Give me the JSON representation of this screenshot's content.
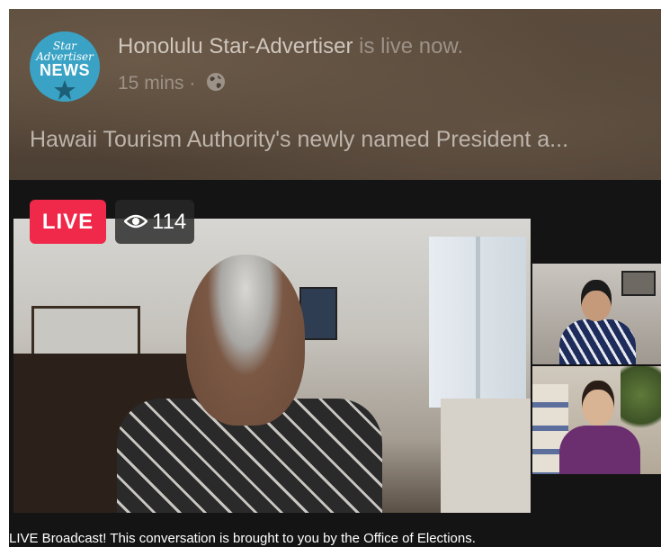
{
  "post": {
    "page_name": "Honolulu Star-Advertiser",
    "status_text": " is live now.",
    "time": "15 mins",
    "separator": " · ",
    "privacy_icon": "globe-icon",
    "caption": "Hawaii Tourism Authority's newly named President a..."
  },
  "avatar": {
    "line1": "Star",
    "line2": "Advertiser",
    "line3": "NEWS"
  },
  "video": {
    "live_label": "LIVE",
    "viewer_icon": "eye-icon",
    "viewer_count": "114"
  },
  "banner": {
    "text": "LIVE Broadcast! This conversation is brought to you by the Office of Elections."
  },
  "colors": {
    "live_red": "#f02849",
    "avatar_blue": "#3aa3c5",
    "header_brown": "#4c3f33"
  }
}
